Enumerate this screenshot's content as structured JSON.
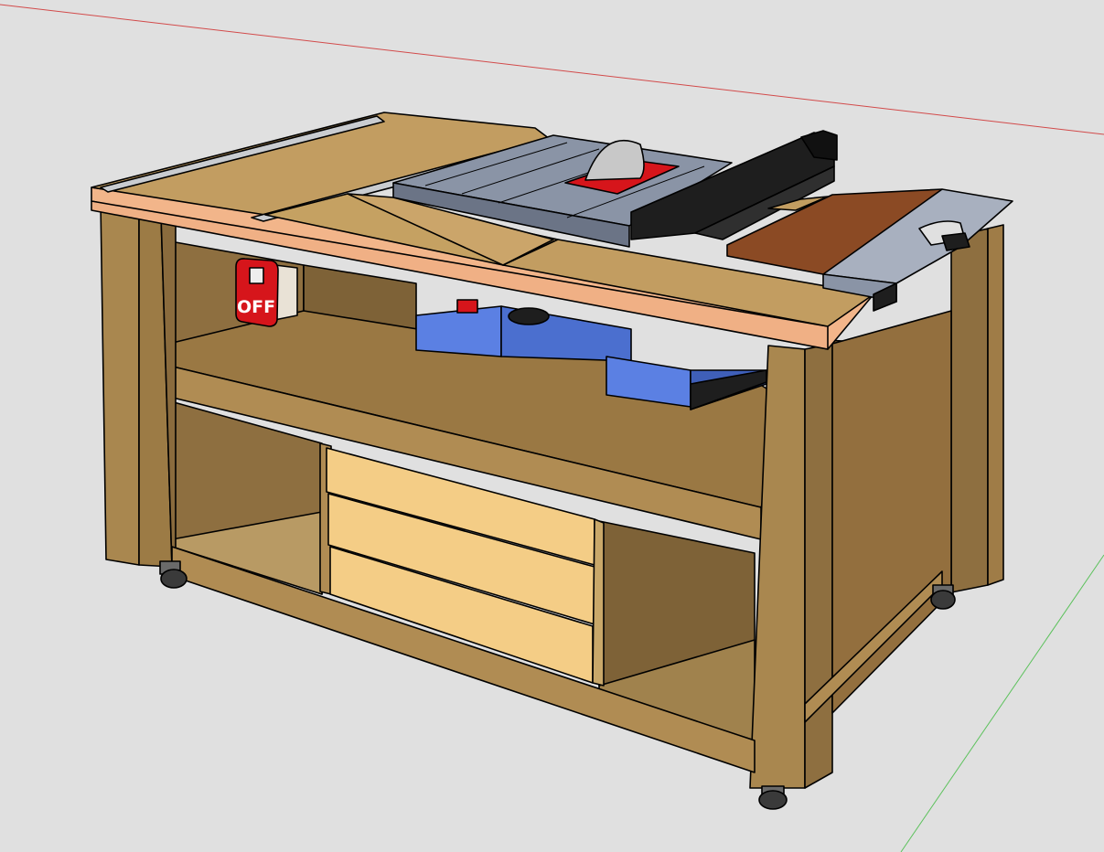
{
  "scene": {
    "background": "#e0e0e0",
    "axis_red": "#d24a4a",
    "axis_green": "#5cc15c"
  },
  "switch": {
    "label": "OFF",
    "color": "#d6151b"
  },
  "colors": {
    "mdf_face": "#b08c53",
    "mdf_dark": "#8e6f40",
    "mdf_light": "#c29d61",
    "top_edge": "#f2b58a",
    "drawer_front": "#f4cd86",
    "saw_gray": "#8a94a6",
    "saw_blue": "#5b80e3",
    "fence_black": "#1e1e1e",
    "walnut": "#8b4a24",
    "caster": "#3a3a3a"
  }
}
